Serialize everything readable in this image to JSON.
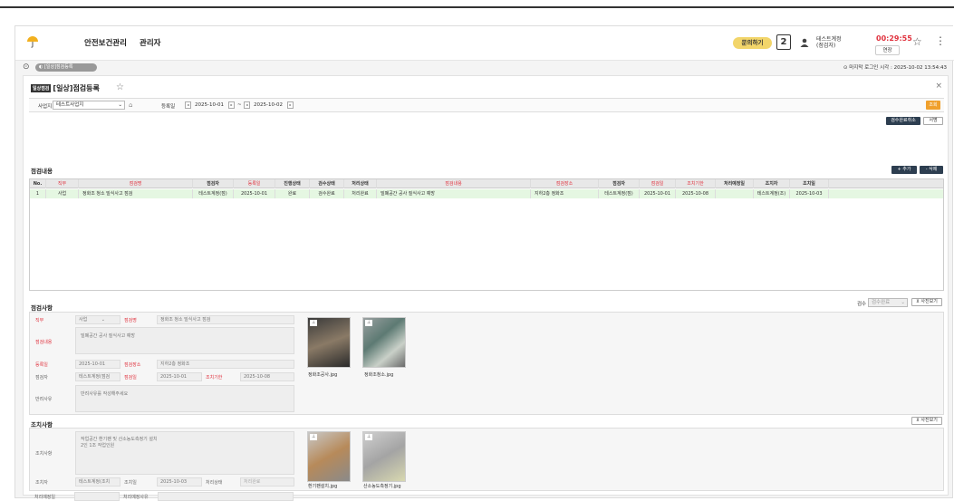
{
  "header": {
    "title": "안전보건관리",
    "admin": "관리자",
    "inquiry": "문의하기",
    "calendar_day": "2",
    "user_name": "테스트계정",
    "user_role": "(점검자)",
    "timer": "00:29:55",
    "extend": "연장"
  },
  "tabbar": {
    "tab": "[일상]점검등록",
    "last_login": "마지막 로그인 시각 : 2025-10-02 13:54:43"
  },
  "page": {
    "badge": "일상점검",
    "title": "[일상]점검등록"
  },
  "filter": {
    "site_label": "사업지",
    "site_value": "테스트사업지",
    "date_label": "등록일",
    "date_from": "2025-10-01",
    "date_sep": "~",
    "date_to": "2025-10-02",
    "search": "조회",
    "review_cancel": "검수완료취소",
    "review": "서명"
  },
  "list": {
    "title": "점검내용",
    "add": "+ 추가",
    "delete": "- 삭제",
    "headers": [
      "No.",
      "직무",
      "점검명",
      "점검자",
      "등록일",
      "진행상태",
      "검수상태",
      "처리상태",
      "점검내용",
      "점검장소",
      "점검자",
      "점검일",
      "조치기한",
      "처리예정일",
      "조치자",
      "조치일"
    ],
    "rows": [
      [
        "1",
        "사업",
        "정화조 청소 밀식사고 점검",
        "테스트계정(점)",
        "2025-10-01",
        "완료",
        "검수완료",
        "처리완료",
        "밀폐공간 공사 질식사고 예방",
        "지하2층 정화조",
        "테스트계정(점)",
        "2025-10-01",
        "2025-10-08",
        "",
        "테스트계정(조)",
        "2025-10-03"
      ]
    ]
  },
  "inspection": {
    "title": "점검사항",
    "review_label": "검수",
    "review_value": "검수완료",
    "photo_btn": "사진보기",
    "job_label": "직무",
    "job_value": "사업",
    "name_label": "점검명",
    "name_value": "정화조 청소 밀식사고 점검",
    "content_label": "점검내용",
    "content_value": "밀폐공간 공사 질식사고 예방",
    "reg_label": "등록일",
    "reg_value": "2025-10-01",
    "place_label": "점검장소",
    "place_value": "지하2층 정화조",
    "inspector_label": "점검자",
    "inspector_value": "테스트계정(점검",
    "date_label": "점검일",
    "date_value": "2025-10-01",
    "deadline_label": "조치기한",
    "deadline_value": "2025-10-08",
    "return_label": "반려사유",
    "return_value": "반려사유를 작성해주세요",
    "photos": [
      "정화조공사.jpg",
      "정화조청소.jpg"
    ]
  },
  "action": {
    "title": "조치사항",
    "photo_btn": "사진보기",
    "content_label": "조치사항",
    "content_value": "작업공간 환기팬 및 산소농도측정기 설치\n2인 1조 작업인원",
    "actor_label": "조치자",
    "actor_value": "테스트계정(조치",
    "date_label": "조치일",
    "date_value": "2025-10-03",
    "status_label": "처리상태",
    "status_value": "처리완료",
    "plan_label": "처리예정일",
    "reason_label": "처리예정사유",
    "photos": [
      "환기팬설치.jpg",
      "산소농도측정기.jpg"
    ]
  }
}
